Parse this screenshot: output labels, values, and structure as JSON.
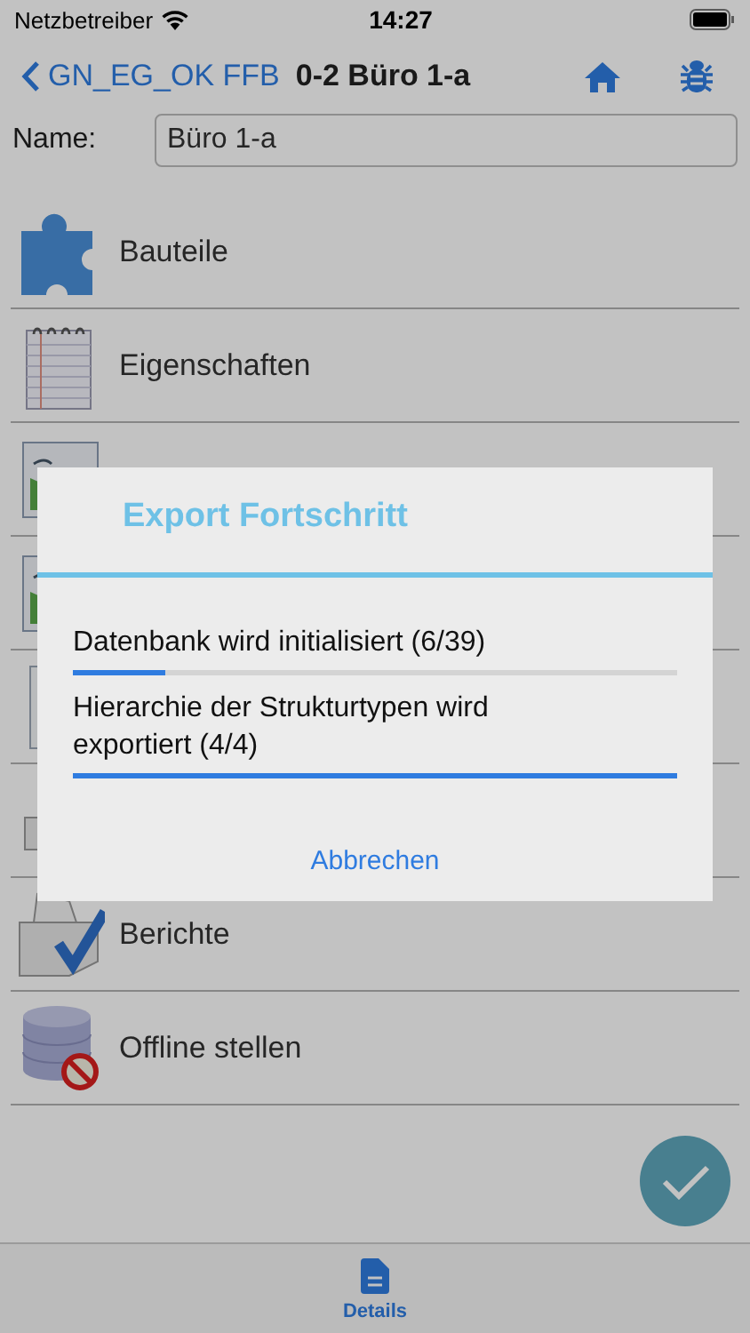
{
  "status_bar": {
    "carrier": "Netzbetreiber",
    "time": "14:27"
  },
  "nav": {
    "back": "GN_EG_OK FFB",
    "title": "0-2 Büro 1-a"
  },
  "name_field": {
    "label": "Name:",
    "value": "Büro 1-a"
  },
  "items": [
    {
      "kind": "puzzle",
      "label": "Bauteile"
    },
    {
      "kind": "notebook",
      "label": "Eigenschaften"
    },
    {
      "kind": "image"
    },
    {
      "kind": "image"
    },
    {
      "kind": "info"
    },
    {
      "kind": "printer"
    },
    {
      "kind": "report",
      "label": "Berichte"
    },
    {
      "kind": "database",
      "label": "Offline stellen"
    }
  ],
  "dialog": {
    "title": "Export Fortschritt",
    "tasks": [
      {
        "label": "Datenbank wird initialisiert (6/39)",
        "level": 0.153
      },
      {
        "label": "Hierarchie der Strukturtypen wird exportiert (4/4)",
        "level": 1
      }
    ],
    "cancel": "Abbrechen"
  },
  "tabs": [
    {
      "label": "Details",
      "selected": true
    }
  ]
}
